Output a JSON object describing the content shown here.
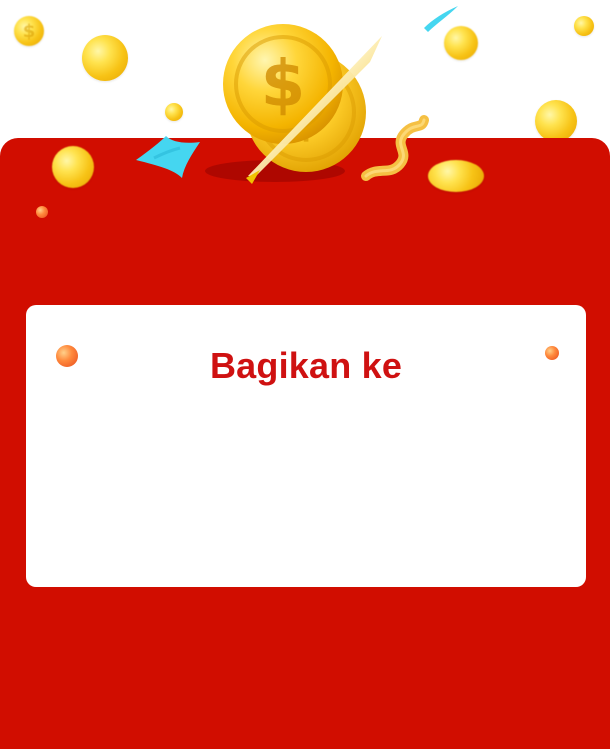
{
  "share": {
    "title": "Bagikan ke"
  },
  "icons": {
    "main": "dollar-coin-icon",
    "sparkle": "coin-sparkle-icon"
  },
  "colors": {
    "red_bg": "#D10D00",
    "title_red": "#CF1111",
    "coin_gold": "#F7C316",
    "cyan_ribbon": "#45D6F0"
  }
}
